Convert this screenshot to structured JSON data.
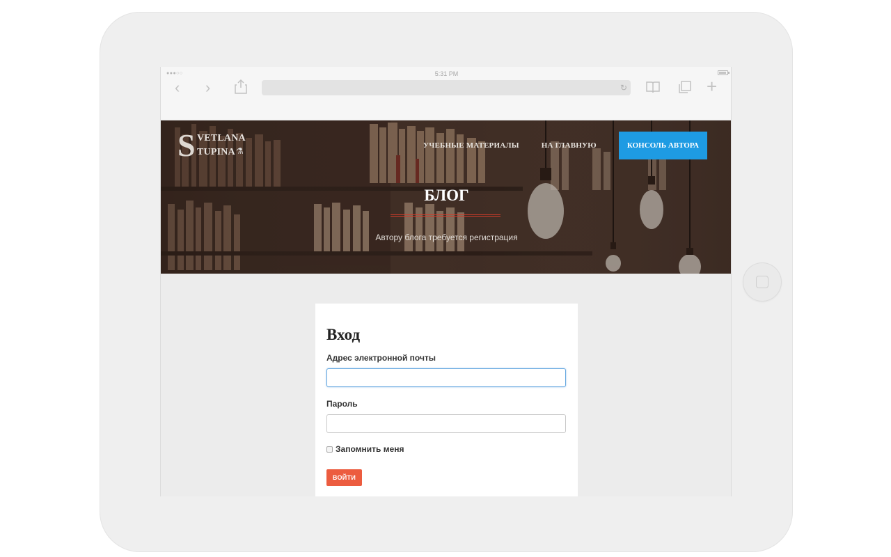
{
  "browser": {
    "status_time": "5:31 PM",
    "signal_dots": "●●●○○",
    "icons": {
      "back": "chevron-left-icon",
      "forward": "chevron-right-icon",
      "share": "share-icon",
      "reload": "reload-icon",
      "bookmarks": "bookmarks-icon",
      "tabs": "tabs-icon",
      "add": "plus-icon"
    },
    "glyphs": {
      "back": "‹",
      "forward": "›",
      "share": "⇪",
      "reload": "↻",
      "bookmarks": "◫",
      "tabs": "❐",
      "add": "+"
    }
  },
  "site": {
    "logo_initial": "S",
    "logo_line1": "VETLANA",
    "logo_line2": "TUPINA",
    "logo_icon_glyph": "⚗",
    "menu": [
      {
        "label": "УЧЕБНЫЕ МАТЕРИАЛЫ"
      },
      {
        "label": "НА ГЛАВНУЮ"
      }
    ],
    "cta_label": "КОНСОЛЬ АВТОРА",
    "cta_color": "#1e9be3",
    "hero_title": "БЛОГ",
    "hero_subtitle": "Автору блога требуется регистрация",
    "accent_color": "#d13c2a"
  },
  "login": {
    "title": "Вход",
    "email_label": "Адрес электронной почты",
    "email_value": "",
    "password_label": "Пароль",
    "password_value": "",
    "remember_label": "Запомнить меня",
    "remember_checked": false,
    "submit_label": "ВОЙТИ",
    "submit_color": "#ec5c3f"
  }
}
